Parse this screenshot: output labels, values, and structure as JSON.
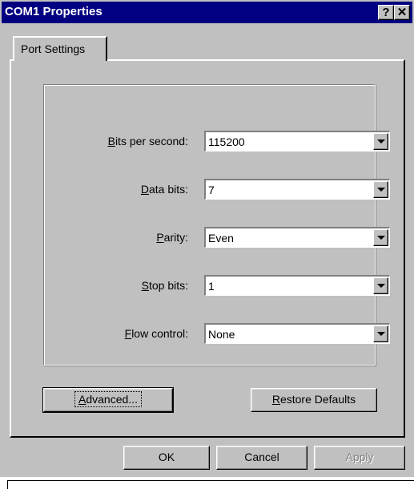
{
  "window": {
    "title": "COM1 Properties",
    "help_button": "?",
    "close_button": "✕"
  },
  "tabs": [
    {
      "label": "Port Settings"
    }
  ],
  "settings": [
    {
      "label_ul": "B",
      "label_rest": "its per second:",
      "value": "115200"
    },
    {
      "label_ul": "D",
      "label_rest": "ata bits:",
      "value": "7"
    },
    {
      "label_ul": "P",
      "label_rest": "arity:",
      "value": "Even"
    },
    {
      "label_ul": "S",
      "label_rest": "top bits:",
      "value": "1"
    },
    {
      "label_ul": "F",
      "label_rest": "low control:",
      "value": "None"
    }
  ],
  "advanced_button": {
    "ul": "A",
    "rest": "dvanced..."
  },
  "restore_button": {
    "ul": "R",
    "rest": "estore Defaults"
  },
  "footer": {
    "ok": "OK",
    "cancel": "Cancel",
    "apply": "Apply"
  },
  "colors": {
    "title_bar": "#000080",
    "face": "#c0c0c0"
  }
}
